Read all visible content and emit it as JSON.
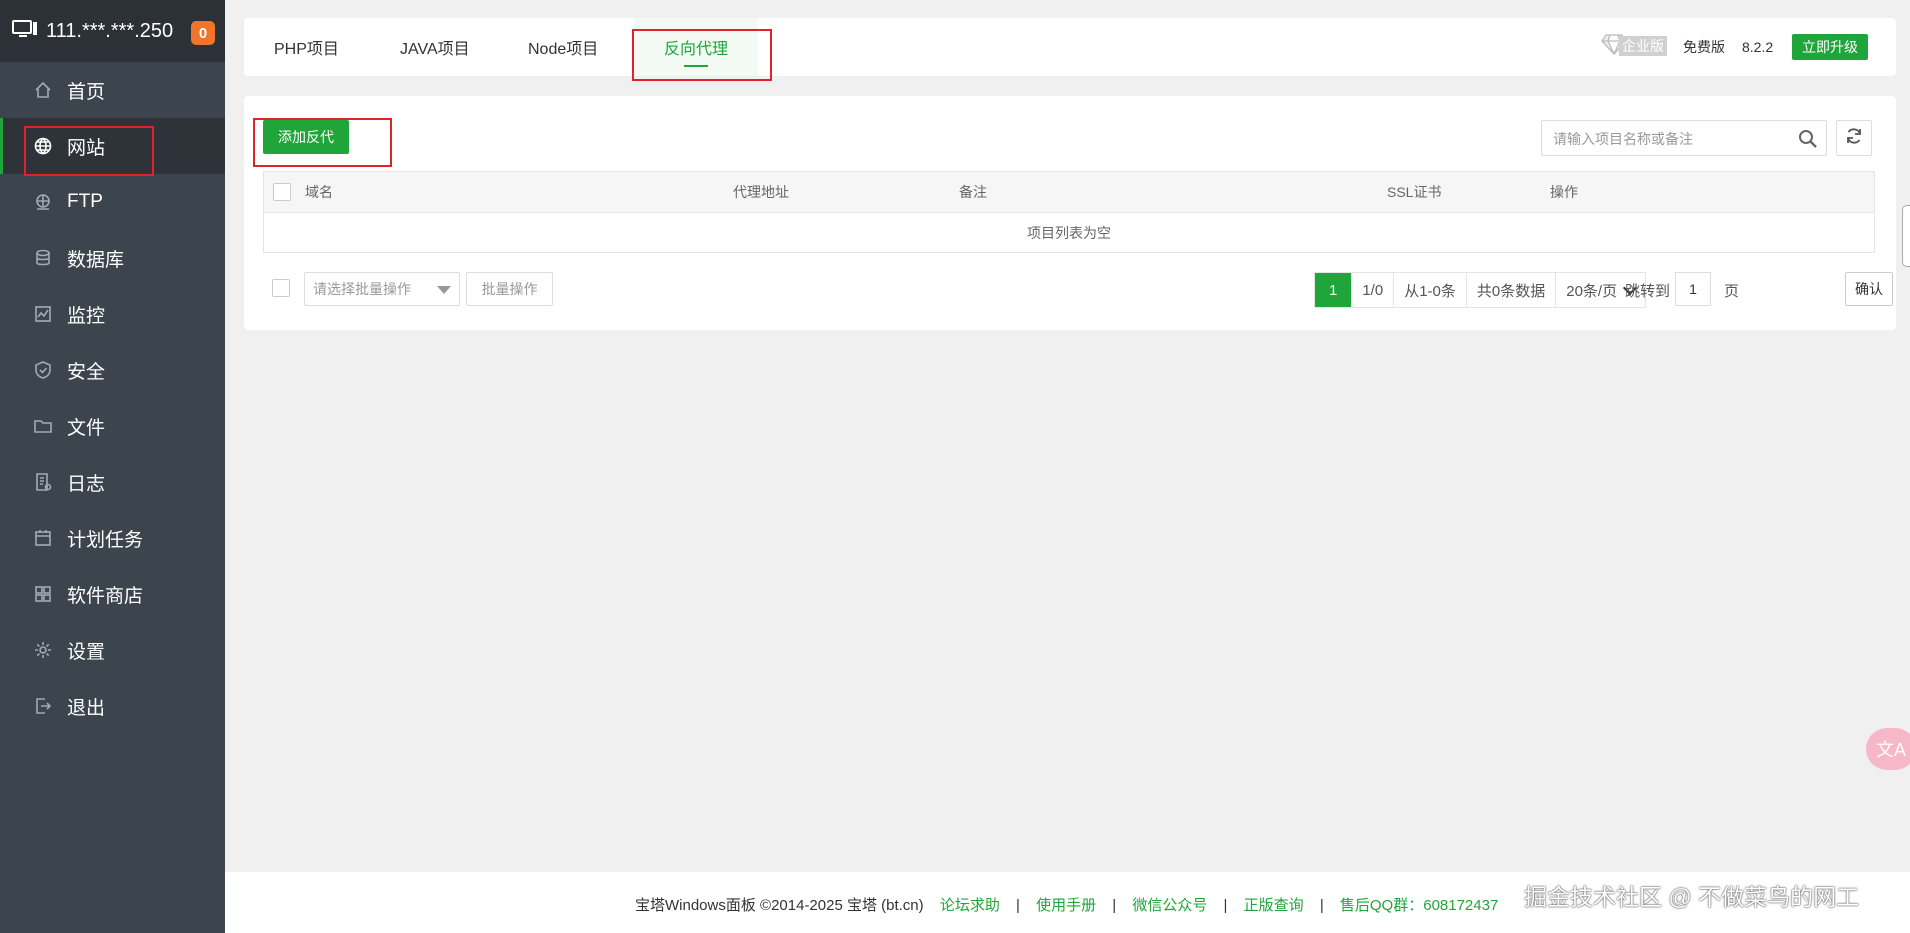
{
  "sidebar": {
    "ip": "111.***.***.250",
    "badge": "0",
    "items": [
      {
        "label": "首页",
        "icon": "home-icon"
      },
      {
        "label": "网站",
        "icon": "globe-icon",
        "active": true
      },
      {
        "label": "FTP",
        "icon": "ftp-icon"
      },
      {
        "label": "数据库",
        "icon": "database-icon"
      },
      {
        "label": "监控",
        "icon": "monitor-icon"
      },
      {
        "label": "安全",
        "icon": "shield-icon"
      },
      {
        "label": "文件",
        "icon": "folder-icon"
      },
      {
        "label": "日志",
        "icon": "log-icon"
      },
      {
        "label": "计划任务",
        "icon": "calendar-icon"
      },
      {
        "label": "软件商店",
        "icon": "apps-icon"
      },
      {
        "label": "设置",
        "icon": "gear-icon"
      },
      {
        "label": "退出",
        "icon": "logout-icon"
      }
    ]
  },
  "tabs": [
    {
      "label": "PHP项目"
    },
    {
      "label": "JAVA项目"
    },
    {
      "label": "Node项目"
    },
    {
      "label": "反向代理",
      "active": true
    }
  ],
  "header": {
    "enterprise_label": "企业版",
    "free_label": "免费版",
    "version": "8.2.2",
    "upgrade_label": "立即升级"
  },
  "toolbar": {
    "add_label": "添加反代",
    "search_placeholder": "请输入项目名称或备注"
  },
  "table": {
    "columns": [
      "域名",
      "代理地址",
      "备注",
      "SSL证书",
      "操作"
    ],
    "rows": [],
    "empty_text": "项目列表为空"
  },
  "batch": {
    "select_placeholder": "请选择批量操作",
    "button_label": "批量操作"
  },
  "pagination": {
    "current_page": "1",
    "page_info": "1/0",
    "range": "从1-0条",
    "total": "共0条数据",
    "per_page": "20条/页",
    "jump_label": "跳转到",
    "jump_value": "1",
    "page_unit": "页",
    "confirm_label": "确认"
  },
  "footer": {
    "copyright": "宝塔Windows面板 ©2014-2025 宝塔 (bt.cn)",
    "links": [
      "论坛求助",
      "使用手册",
      "微信公众号",
      "正版查询",
      "售后QQ群：608172437"
    ],
    "separator": "|"
  },
  "watermark": "掘金技术社区 @ 不做菜鸟的网工",
  "translate_widget": "文A",
  "colors": {
    "accent": "#20a53a",
    "sidebar_bg": "#3c444d",
    "sidebar_header_bg": "#2c3138",
    "badge": "#f0742a",
    "highlight_box": "#e0232b"
  }
}
